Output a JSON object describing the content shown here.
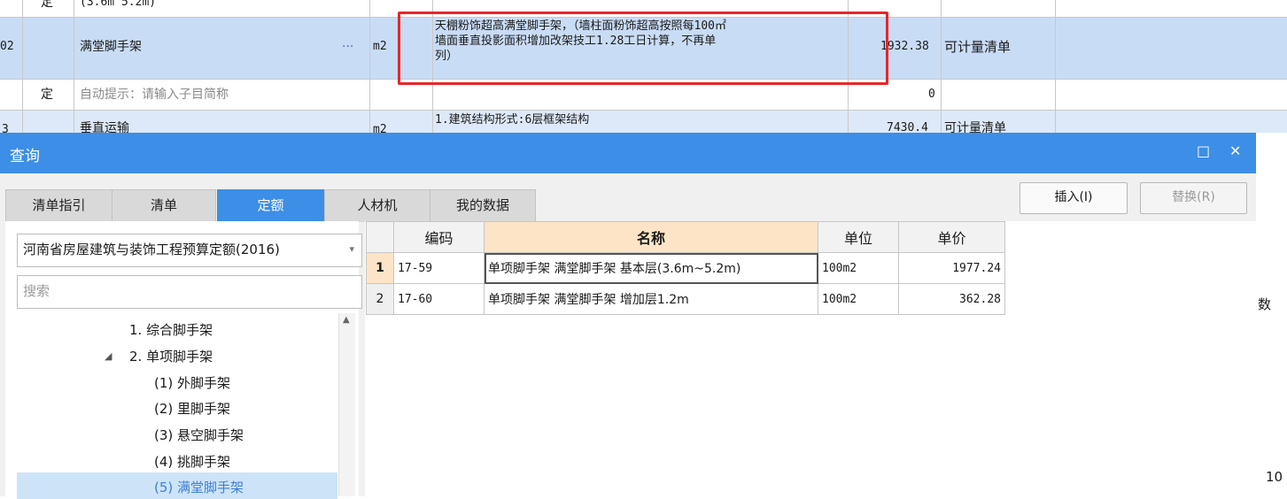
{
  "background": {
    "row0": {
      "col_type": "定",
      "desc": "(3.6m 5.2m)"
    },
    "row1": {
      "id_frag": "02",
      "name": "满堂脚手架",
      "more": "···",
      "unit": "m2",
      "desc_lines": [
        "天棚粉饰超高满堂脚手架，（墙柱面粉饰超高按照每100㎡",
        "墙面垂直投影面积增加改架技工1.28工日计算，不再单",
        "列）"
      ],
      "value": "1932.38",
      "label": "可计量清单"
    },
    "row2": {
      "col_type": "定",
      "hint": "自动提示：请输入子目简称",
      "value": "0"
    },
    "row3": {
      "id_frag": "3",
      "name": "垂直运输",
      "unit": "m2",
      "desc": "1.建筑结构形式:6层框架结构",
      "value": "7430.4",
      "label": "可计量清单"
    }
  },
  "dialog": {
    "title": "查询",
    "maximize_glyph": "□",
    "close_glyph": "✕",
    "tabs": [
      "清单指引",
      "清单",
      "定额",
      "人材机",
      "我的数据"
    ],
    "active_tab": "定额",
    "insert_label": "插入(I)",
    "replace_label": "替换(R)",
    "quota_select": "河南省房屋建筑与装饰工程预算定额(2016)",
    "search_placeholder": "搜索",
    "tree": [
      {
        "label": "1. 综合脚手架"
      },
      {
        "label": "2. 单项脚手架",
        "toggle": "◢"
      },
      {
        "label": "(1) 外脚手架"
      },
      {
        "label": "(2) 里脚手架"
      },
      {
        "label": "(3) 悬空脚手架"
      },
      {
        "label": "(4) 挑脚手架"
      },
      {
        "label": "(5) 满堂脚手架"
      }
    ],
    "selected_tree_item": "(5) 满堂脚手架",
    "table": {
      "headers": [
        "编码",
        "名称",
        "单位",
        "单价"
      ],
      "rows": [
        {
          "num": "1",
          "code": "17-59",
          "name": "单项脚手架 满堂脚手架 基本层(3.6m~5.2m)",
          "unit": "100m2",
          "price": "1977.24"
        },
        {
          "num": "2",
          "code": "17-60",
          "name": "单项脚手架 满堂脚手架 增加层1.2m",
          "unit": "100m2",
          "price": "362.28"
        }
      ]
    },
    "right_edge": {
      "frag1": "数",
      "frag2": "10"
    }
  }
}
